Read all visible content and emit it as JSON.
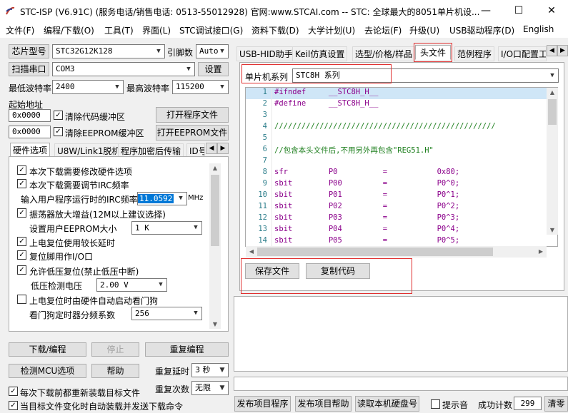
{
  "window": {
    "title": "STC-ISP (V6.91C) (服务电话/销售电话: 0513-55012928) 官网:www.STCAI.com  -- STC: 全球最大的8051单片机设...",
    "minimize_icon": "minimize-icon",
    "maximize_icon": "maximize-icon",
    "close_icon": "close-icon"
  },
  "menu": [
    "文件(F)",
    "编程/下载(O)",
    "工具(T)",
    "界面(L)",
    "STC调试接口(G)",
    "资料下载(D)",
    "大学计划(U)",
    "去论坛(F)",
    "升级(U)",
    "USB驱动程序(D)",
    "English"
  ],
  "left": {
    "chip_type_label": "芯片型号",
    "chip_type_value": "STC32G12K128",
    "pin_count_label": "引脚数",
    "pin_count_value": "Auto",
    "scan_port_button": "扫描串口",
    "port_value": "COM3",
    "settings_button": "设置",
    "min_baud_label": "最低波特率",
    "min_baud_value": "2400",
    "max_baud_label": "最高波特率",
    "max_baud_value": "115200",
    "start_addr_label": "起始地址",
    "code_addr_value": "0x0000",
    "clear_code_label": "清除代码缓冲区",
    "open_program_button": "打开程序文件",
    "eeprom_addr_value": "0x0000",
    "clear_eeprom_label": "清除EEPROM缓冲区",
    "open_eeprom_button": "打开EEPROM文件",
    "tabs": [
      "硬件选项",
      "U8W/Link1脱机",
      "程序加密后传输",
      "ID号"
    ],
    "options": {
      "opt1": "本次下载需要修改硬件选项",
      "opt2": "本次下载需要调节IRC频率",
      "irc_label": "输入用户程序运行时的IRC频率",
      "irc_value": "11.0592",
      "irc_unit": "MHz",
      "opt3": "振荡器放大增益(12M以上建议选择)",
      "eeprom_size_label": "设置用户EEPROM大小",
      "eeprom_size_value": "1    K",
      "opt4": "上电复位使用较长延时",
      "opt5": "复位脚用作I/O口",
      "opt6": "允许低压复位(禁止低压中断)",
      "lvd_label": "低压检测电压",
      "lvd_value": "2.00 V",
      "opt7": "上电复位时由硬件自动启动看门狗",
      "wdt_label": "看门狗定时器分频系数",
      "wdt_value": "256"
    },
    "download_button": "下载/编程",
    "stop_button": "停止",
    "reprogram_button": "重复编程",
    "detect_mcu_button": "检测MCU选项",
    "help_button": "帮助",
    "repeat_delay_label": "重复延时",
    "repeat_delay_value": "3 秒",
    "repeat_count_label": "重复次数",
    "repeat_count_value": "无限",
    "reload_label": "每次下载前都重新装载目标文件",
    "auto_load_label": "当目标文件变化时自动装载并发送下载命令"
  },
  "right": {
    "tabs": [
      "USB-HID助手",
      "Keil仿真设置",
      "选型/价格/样品",
      "头文件",
      "范例程序",
      "I/O口配置工"
    ],
    "active_tab": "头文件",
    "series_label": "单片机系列",
    "series_value": "STC8H 系列",
    "code_lines": [
      {
        "n": "1",
        "t": "#ifndef     __STC8H_H__"
      },
      {
        "n": "2",
        "t": "#define     __STC8H_H__"
      },
      {
        "n": "3",
        "t": ""
      },
      {
        "n": "4",
        "t": "/////////////////////////////////////////////////"
      },
      {
        "n": "5",
        "t": ""
      },
      {
        "n": "6",
        "t": "//包含本头文件后,不用另外再包含\"REG51.H\""
      },
      {
        "n": "7",
        "t": ""
      },
      {
        "n": "8",
        "t": "sfr         P0          =           0x80;"
      },
      {
        "n": "9",
        "t": "sbit        P00         =           P0^0;"
      },
      {
        "n": "10",
        "t": "sbit        P01         =           P0^1;"
      },
      {
        "n": "11",
        "t": "sbit        P02         =           P0^2;"
      },
      {
        "n": "12",
        "t": "sbit        P03         =           P0^3;"
      },
      {
        "n": "13",
        "t": "sbit        P04         =           P0^4;"
      },
      {
        "n": "14",
        "t": "sbit        P05         =           P0^5;"
      }
    ],
    "save_file_button": "保存文件",
    "copy_code_button": "复制代码",
    "publish_program_button": "发布项目程序",
    "publish_help_button": "发布项目帮助",
    "read_disk_button": "读取本机硬盘号",
    "sound_label": "提示音",
    "success_count_label": "成功计数",
    "success_count_value": "299",
    "clear_button": "清零"
  },
  "colors": {
    "accent_red": "#e03030",
    "selection": "#0078d7",
    "code_keyword": "#8b008b",
    "code_comment": "#1e7f1e"
  }
}
